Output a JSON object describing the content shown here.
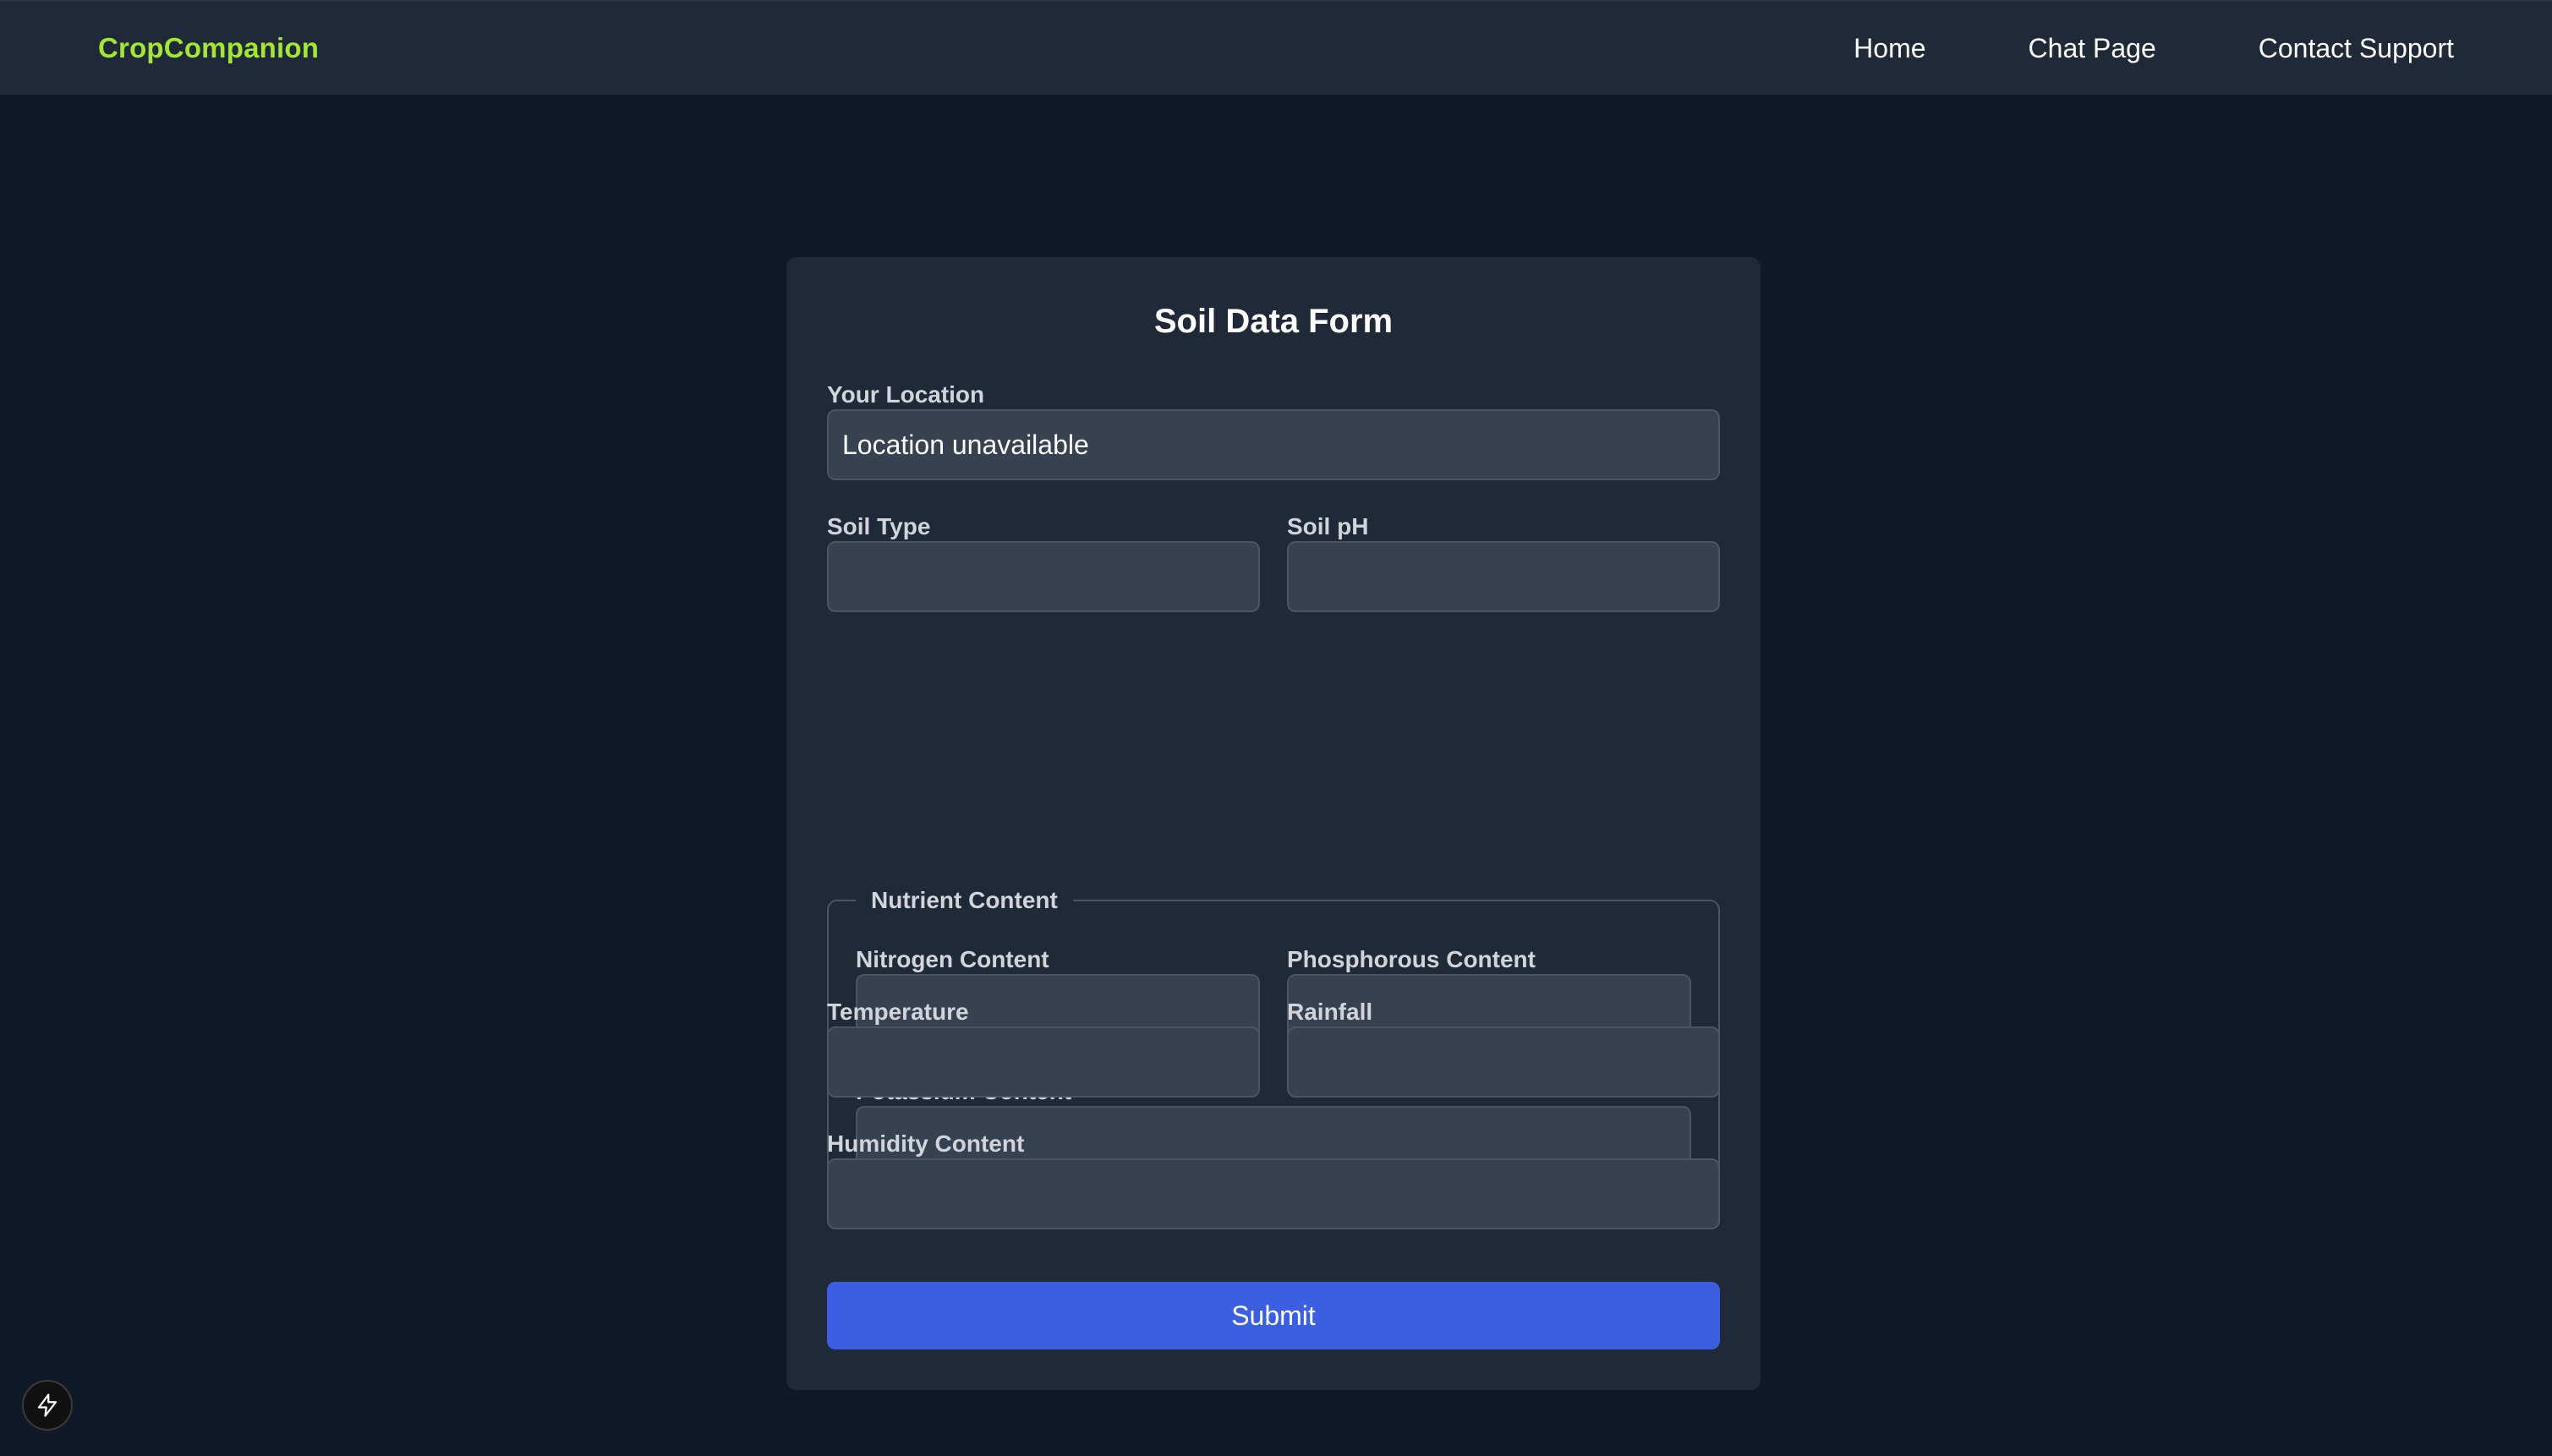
{
  "navbar": {
    "brand": "CropCompanion",
    "links": [
      "Home",
      "Chat Page",
      "Contact Support"
    ]
  },
  "form": {
    "title": "Soil Data Form",
    "location": {
      "label": "Your Location",
      "value": "Location unavailable"
    },
    "soil_type": {
      "label": "Soil Type",
      "value": ""
    },
    "soil_ph": {
      "label": "Soil pH",
      "value": ""
    },
    "nutrients": {
      "legend": "Nutrient Content",
      "nitrogen": {
        "label": "Nitrogen Content",
        "value": ""
      },
      "phosphorous": {
        "label": "Phosphorous Content",
        "value": ""
      },
      "potassium": {
        "label": "Potassium Content",
        "value": ""
      }
    },
    "temperature": {
      "label": "Temperature",
      "value": ""
    },
    "rainfall": {
      "label": "Rainfall",
      "value": ""
    },
    "humidity": {
      "label": "Humidity Content",
      "value": ""
    },
    "submit_label": "Submit"
  },
  "colors": {
    "brand": "#a3e635",
    "submit": "#3b5fe0",
    "background": "#111827",
    "panel": "#1f2937"
  },
  "icons": {
    "floating_button": "lightning-bolt-icon"
  }
}
